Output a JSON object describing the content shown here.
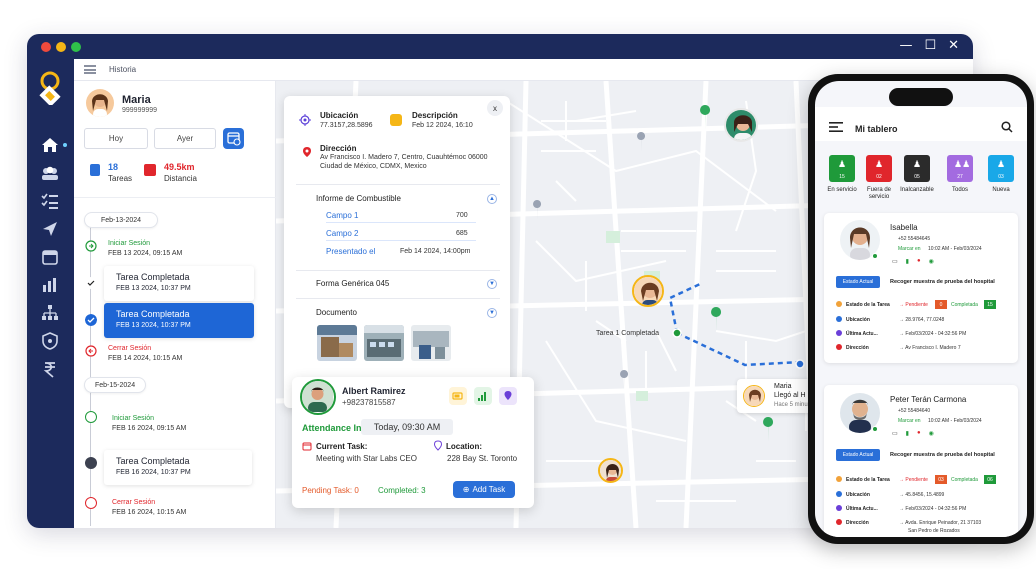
{
  "window": {
    "breadcrumb": "Historia"
  },
  "sidebar": {
    "icons": [
      "home-icon",
      "team-icon",
      "tasks-icon",
      "navigation-icon",
      "calendar-icon",
      "reports-icon",
      "hierarchy-icon",
      "shield-icon",
      "rupee-icon"
    ]
  },
  "profile": {
    "name": "Maria",
    "phone": "999999999"
  },
  "filters": {
    "today": "Hoy",
    "yesterday": "Ayer"
  },
  "stats": {
    "tasks_value": "18",
    "tasks_label": "Tareas",
    "distance_value": "49.5km",
    "distance_label": "Distancia"
  },
  "timeline": {
    "date1": "Feb-13-2024",
    "date2": "Feb-15-2024",
    "items": [
      {
        "title": "Iniciar Sesión",
        "sub": "FEB 13 2024, 09:15 AM"
      },
      {
        "title": "Tarea Completada",
        "sub": "FEB 13 2024, 10:37 PM"
      },
      {
        "title": "Tarea Completada",
        "sub": "FEB 13 2024, 10:37 PM"
      },
      {
        "title": "Cerrar Sesión",
        "sub": "FEB 14 2024, 10:15 AM"
      },
      {
        "title": "Iniciar Sesión",
        "sub": "FEB 16 2024, 09:15 AM"
      },
      {
        "title": "Tarea Completada",
        "sub": "FEB 16 2024, 10:37 PM"
      },
      {
        "title": "Cerrar Sesión",
        "sub": "FEB 16 2024, 10:15 AM"
      }
    ]
  },
  "popup": {
    "close": "x",
    "location_label": "Ubicación",
    "location_value": "77.3157,28.5896",
    "description_label": "Descripción",
    "description_value": "Feb 12 2024, 16:10",
    "address_label": "Dirección",
    "address_line1": "Av Francisco I. Madero 7, Centro, Cuauhtémoc 06000",
    "address_line2": "Ciudad de México, CDMX, Mexico",
    "fuel_title": "Informe de Combustible",
    "fields": [
      {
        "label": "Campo 1",
        "value": "700"
      },
      {
        "label": "Campo 2",
        "value": "685"
      },
      {
        "label": "Presentado el",
        "value": "Feb 14 2024, 14:00pm"
      }
    ],
    "generic_form": "Forma Genérica 045",
    "document_title": "Documento"
  },
  "employee": {
    "name": "Albert Ramirez",
    "phone": "+98237815587",
    "attendance_label": "Attendance In:",
    "attendance_value": "Today, 09:30 AM",
    "current_task_label": "Current Task:",
    "current_task_value": "Meeting with Star Labs CEO",
    "location_label": "Location:",
    "location_value": "228 Bay St. Toronto",
    "pending": "Pending Task: 0",
    "completed": "Completed: 3",
    "add_task": "Add Task"
  },
  "map": {
    "route_label": "Tarea 1 Completada",
    "tip_name": "Maria",
    "tip_status": "Llegó al H",
    "tip_time": "Hace 5 minu"
  },
  "mobile": {
    "title": "Mi tablero",
    "tiles": [
      {
        "count": "15",
        "label": "En servicio",
        "color": "#1f9a3a"
      },
      {
        "count": "02",
        "label": "Fuera de servicio",
        "color": "#e0262c"
      },
      {
        "count": "05",
        "label": "Inalcanzable",
        "color": "#2b2b2b"
      },
      {
        "count": "27",
        "label": "Todos",
        "color": "#a36be0"
      },
      {
        "count": "03",
        "label": "Nueva",
        "color": "#19a8e8"
      }
    ],
    "cards": [
      {
        "name": "Isabella",
        "phone": "+52 55484645",
        "marcar": "Marcar en",
        "date": "10:02 AM - Feb/03/2024",
        "status_btn": "Estado Actual",
        "task": "Recoger muestra de prueba del hospital",
        "estado_label": "Estado de la Tarea",
        "pending_label": "Pendiente",
        "pending_count": "0",
        "completed_label": "Completada",
        "completed_count": "15",
        "ubicacion_label": "Ubicación",
        "ubicacion": "28.9764, 77.0248",
        "ultima_label": "Última Actu...",
        "ultima": "Feb/03/2024 -   04:32:56 PM",
        "direccion_label": "Dirección",
        "direccion": "Av Francisco I. Madero 7"
      },
      {
        "name": "Peter Terán Carmona",
        "phone": "+52 55484640",
        "marcar": "Marcar en",
        "date": "10:02 AM - Feb/03/2024",
        "status_btn": "Estado Actual",
        "task": "Recoger muestra de prueba del hospital",
        "estado_label": "Estado de la Tarea",
        "pending_label": "Pendiente",
        "pending_count": "03",
        "completed_label": "Completada",
        "completed_count": "06",
        "ubicacion_label": "Ubicación",
        "ubicacion": "45.8456, 15.4899",
        "ultima_label": "Última Actu...",
        "ultima": "Feb/03/2024 -   04:32:56 PM",
        "direccion_label": "Dirección",
        "direccion": "Avda. Enrique Peinador, 21 37103",
        "direccion2": "San Pedro de Rozados"
      }
    ]
  },
  "colors": {
    "navy": "#1c2a5c",
    "primary": "#2a6fd8",
    "green": "#1f9a3a",
    "red": "#e0262c",
    "marker_yellow": "#f5b616"
  }
}
